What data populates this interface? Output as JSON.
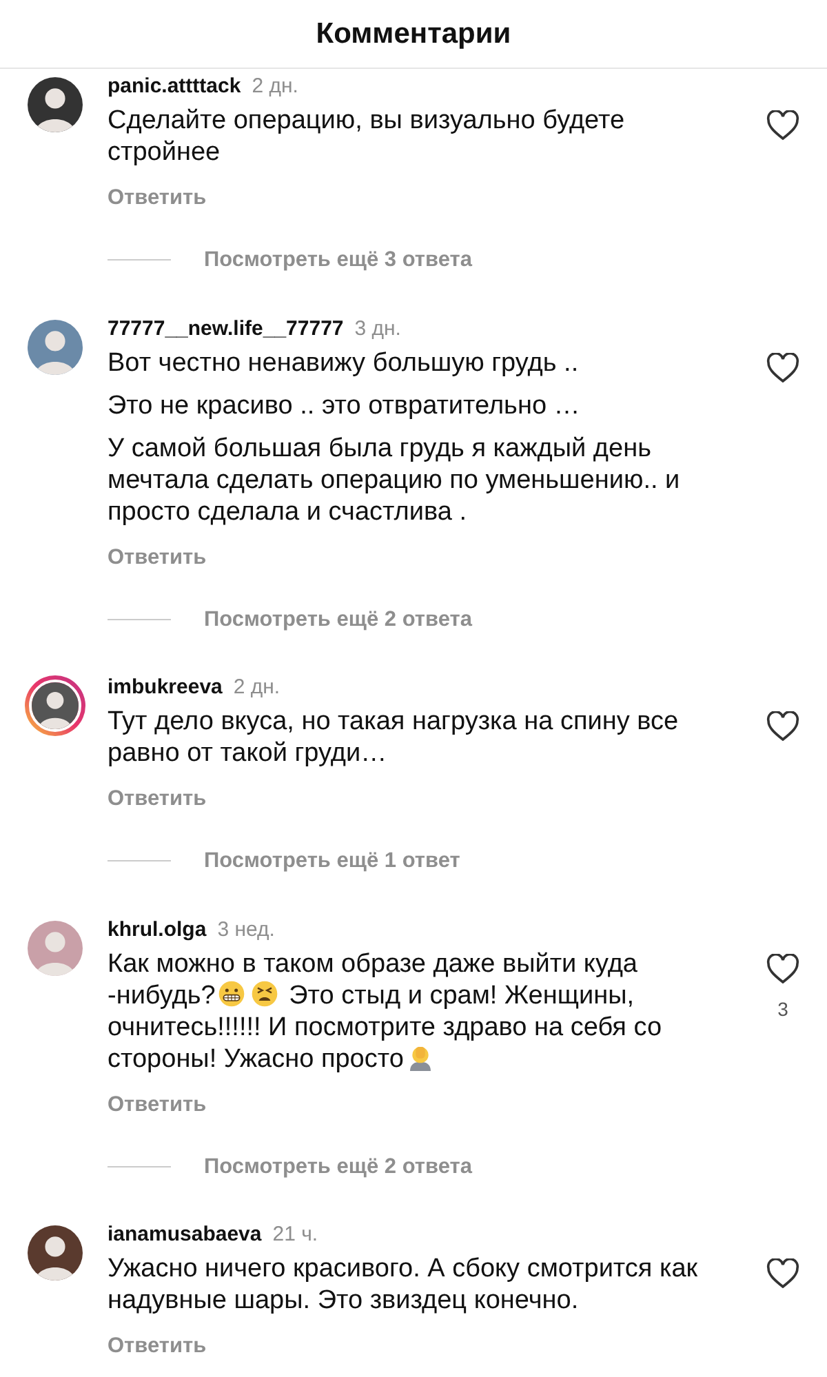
{
  "header": {
    "title": "Комментарии"
  },
  "comments": [
    {
      "username": "panic.attttack",
      "time": "2 дн.",
      "story_ring": false,
      "liked": false,
      "paragraphs": [
        [
          {
            "kind": "text",
            "text": "Сделайте операцию, вы визуально будете стройнее"
          }
        ]
      ],
      "reply": "Ответить",
      "view_replies": "Посмотреть ещё 3 ответа"
    },
    {
      "username": "77777__new.life__77777",
      "time": "3 дн.",
      "story_ring": false,
      "liked": false,
      "paragraphs": [
        [
          {
            "kind": "text",
            "text": "Вот честно ненавижу большую грудь .."
          }
        ],
        [
          {
            "kind": "text",
            "text": "Это не красиво .. это отвратительно …"
          }
        ],
        [
          {
            "kind": "text",
            "text": "У самой большая была грудь я каждый день мечтала сделать операцию по уменьшению.. и просто сделала и счастлива ."
          }
        ]
      ],
      "reply": "Ответить",
      "view_replies": "Посмотреть ещё 2 ответа"
    },
    {
      "username": "imbukreeva",
      "time": "2 дн.",
      "story_ring": true,
      "liked": false,
      "paragraphs": [
        [
          {
            "kind": "text",
            "text": "Тут дело вкуса, но такая нагрузка на спину все равно от такой груди…"
          }
        ]
      ],
      "reply": "Ответить",
      "view_replies": "Посмотреть ещё 1 ответ"
    },
    {
      "username": "khrul.olga",
      "time": "3 нед.",
      "story_ring": false,
      "liked": false,
      "likes": "3",
      "paragraphs": [
        [
          {
            "kind": "text",
            "text": "Как можно в таком образе даже выйти куда -нибудь?"
          },
          {
            "kind": "grimace"
          },
          {
            "kind": "tired"
          },
          {
            "kind": "text",
            "text": " Это стыд и срам! Женщины, очнитесь!!!!!! И посмотрите здраво на себя со стороны!  Ужасно просто"
          },
          {
            "kind": "facepalm"
          }
        ]
      ],
      "reply": "Ответить",
      "view_replies": "Посмотреть ещё 2 ответа"
    },
    {
      "username": "ianamusabaeva",
      "time": "21 ч.",
      "story_ring": false,
      "liked": false,
      "paragraphs": [
        [
          {
            "kind": "text",
            "text": "Ужасно ничего красивого. А сбоку смотрится как надувные шары. Это звиздец конечно."
          }
        ]
      ],
      "reply": "Ответить"
    }
  ]
}
